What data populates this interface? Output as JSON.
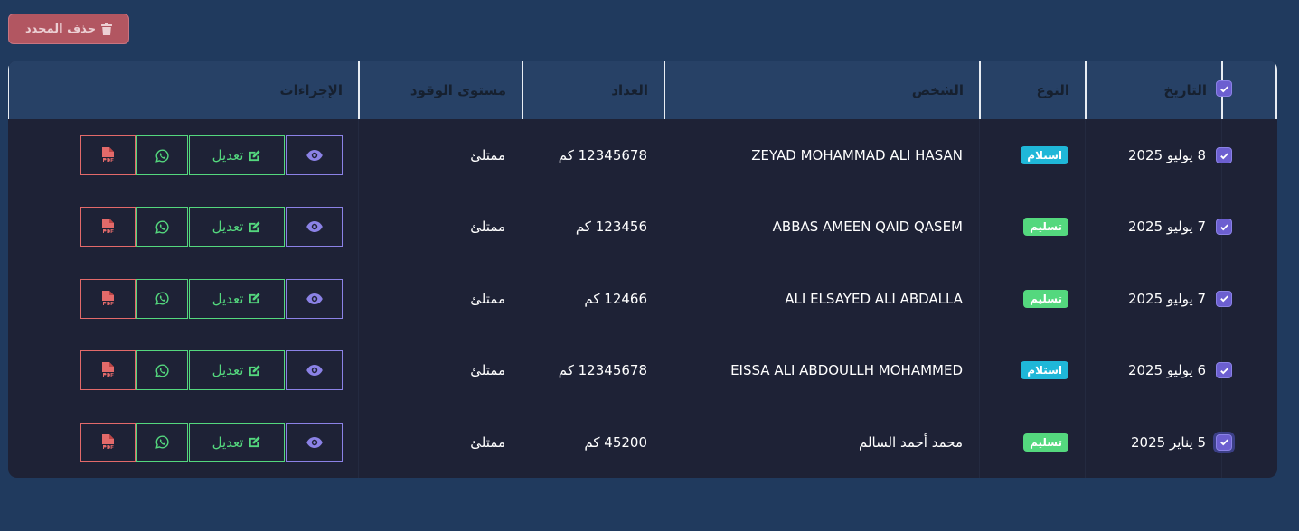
{
  "toolbar": {
    "delete_selected_label": "حذف المحدد"
  },
  "table": {
    "headers": {
      "date": "التاريخ",
      "type": "النوع",
      "person": "الشخص",
      "odometer": "العداد",
      "fuel_level": "مستوى الوقود",
      "actions": "الإجراءات"
    },
    "edit_label": "تعديل",
    "rows": [
      {
        "date": "8 يوليو 2025",
        "type": "استلام",
        "type_kind": "receive",
        "person": "ZEYAD MOHAMMAD ALI HASAN",
        "odometer": "12345678 كم",
        "fuel_level": "ممتلئ",
        "checked": true
      },
      {
        "date": "7 يوليو 2025",
        "type": "تسليم",
        "type_kind": "deliver",
        "person": "ABBAS AMEEN QAID QASEM",
        "odometer": "123456 كم",
        "fuel_level": "ممتلئ",
        "checked": true
      },
      {
        "date": "7 يوليو 2025",
        "type": "تسليم",
        "type_kind": "deliver",
        "person": "ALI ELSAYED ALI ABDALLA",
        "odometer": "12466 كم",
        "fuel_level": "ممتلئ",
        "checked": true
      },
      {
        "date": "6 يوليو 2025",
        "type": "استلام",
        "type_kind": "receive",
        "person": "EISSA ALI ABDOULLH MOHAMMED",
        "odometer": "12345678 كم",
        "fuel_level": "ممتلئ",
        "checked": true
      },
      {
        "date": "5 يناير 2025",
        "type": "تسليم",
        "type_kind": "deliver",
        "person": "محمد أحمد السالم",
        "odometer": "45200 كم",
        "fuel_level": "ممتلئ",
        "checked": true
      }
    ]
  },
  "colors": {
    "page_bg": "#203a5e",
    "table_bg": "#1e2236",
    "header_bg": "#274166",
    "checkbox": "#6c5fd0",
    "badge_receive": "#1fb7d8",
    "badge_deliver": "#54d87e",
    "delete_button": "#b25661",
    "pdf_red": "#e36a6a"
  },
  "icons": {
    "delete": "trash-icon",
    "view": "eye-icon",
    "edit": "edit-icon",
    "whatsapp": "whatsapp-icon",
    "pdf": "pdf-file-icon",
    "checkbox": "checkmark-icon"
  }
}
